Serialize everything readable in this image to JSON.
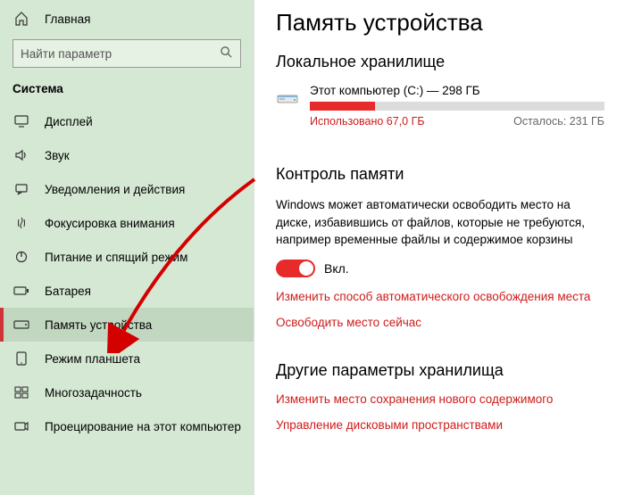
{
  "sidebar": {
    "home_label": "Главная",
    "search_placeholder": "Найти параметр",
    "group_label": "Система",
    "items": [
      {
        "label": "Дисплей",
        "icon": "display"
      },
      {
        "label": "Звук",
        "icon": "sound"
      },
      {
        "label": "Уведомления и действия",
        "icon": "notifications"
      },
      {
        "label": "Фокусировка внимания",
        "icon": "focus"
      },
      {
        "label": "Питание и спящий режим",
        "icon": "power"
      },
      {
        "label": "Батарея",
        "icon": "battery"
      },
      {
        "label": "Память устройства",
        "icon": "storage"
      },
      {
        "label": "Режим планшета",
        "icon": "tablet"
      },
      {
        "label": "Многозадачность",
        "icon": "multitask"
      },
      {
        "label": "Проецирование на этот компьютер",
        "icon": "project"
      }
    ],
    "selected_index": 6
  },
  "page": {
    "title": "Память устройства",
    "local_storage": {
      "section_title": "Локальное хранилище",
      "drive_label": "Этот компьютер (C:) — 298 ГБ",
      "used_label": "Использовано 67,0 ГБ",
      "remaining_label": "Осталось: 231 ГБ",
      "used_percent": 22
    },
    "storage_sense": {
      "section_title": "Контроль памяти",
      "description": "Windows может автоматически освободить место на диске, избавившись от файлов, которые не требуются, например временные файлы и содержимое корзины",
      "toggle_on": true,
      "toggle_label": "Вкл.",
      "link_change": "Изменить способ автоматического освобождения места",
      "link_free_now": "Освободить место сейчас"
    },
    "other": {
      "section_title": "Другие параметры хранилища",
      "link_change_save": "Изменить место сохранения нового содержимого",
      "link_manage_spaces": "Управление дисковыми пространствами"
    }
  },
  "colors": {
    "accent": "#e72a2a",
    "sidebar_bg": "#d5e8d4",
    "link": "#cf1b1b"
  }
}
